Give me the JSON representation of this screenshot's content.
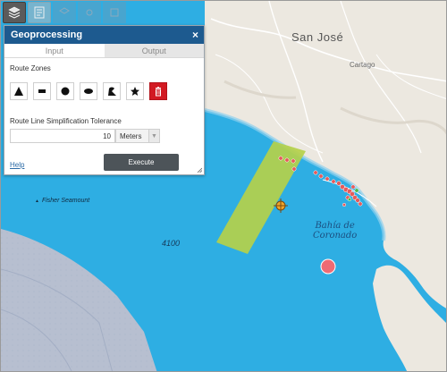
{
  "map": {
    "labels": {
      "city_main": "San José",
      "city_small": "Cartago",
      "bay_line1": "Bahía de",
      "bay_line2": "Coronado",
      "depth": "4100",
      "seamount": "Fisher Seamount"
    },
    "colors": {
      "ocean": "#2eaee3",
      "land": "#ece8e0",
      "route_zone": "#b5d04a",
      "incidents": "#e65a5a"
    }
  },
  "toolbar": {
    "buttons": [
      {
        "icon": "basemap-gallery-icon",
        "state": "active"
      },
      {
        "icon": "legend-icon",
        "state": "faded"
      },
      {
        "icon": "layers-icon",
        "state": "dim"
      },
      {
        "icon": "tool-icon",
        "state": "dim"
      },
      {
        "icon": "widget-icon",
        "state": "dim"
      }
    ]
  },
  "panel": {
    "title": "Geoprocessing",
    "close_symbol": "×",
    "tabs": [
      {
        "label": "Input"
      },
      {
        "label": "Output"
      }
    ],
    "zones_label": "Route Zones",
    "shape_tools": [
      "triangle-icon",
      "rectangle-icon",
      "circle-icon",
      "ellipse-icon",
      "freehand-polygon-icon",
      "star-icon",
      "trash-icon"
    ],
    "tolerance_label": "Route Line Simplification Tolerance",
    "tolerance_value": "10",
    "unit_value": "Meters",
    "help_label": "Help",
    "execute_label": "Execute"
  }
}
